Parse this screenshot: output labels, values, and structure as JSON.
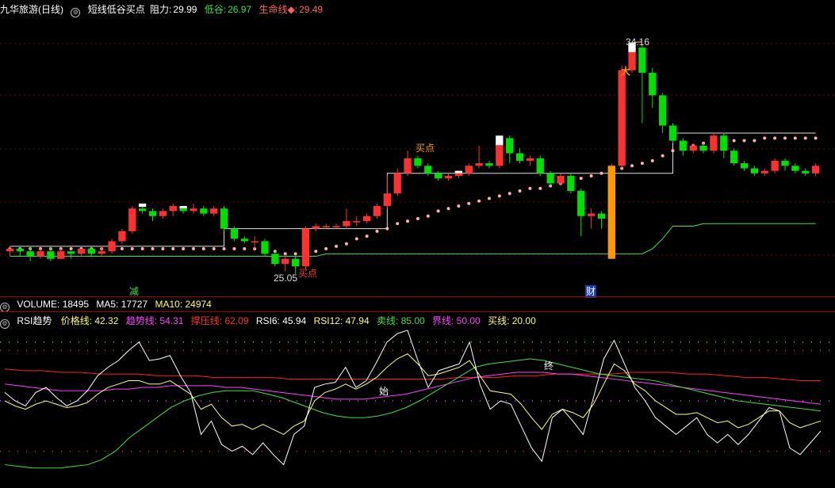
{
  "main": {
    "title": "九华旅游(日线)",
    "indicator": "短线低谷买点",
    "resistance_label": "阻力:",
    "resistance_value": "29.99",
    "valley_label": "低谷:",
    "valley_value": "26.97",
    "life_label": "生命线◆:",
    "life_value": "29.49",
    "high_label": "34.16",
    "low_label": "25.05",
    "buy_label": "买点",
    "marker_left": "减",
    "marker_right": "财",
    "signal_char": "大"
  },
  "volume": {
    "label": "VOLUME: 18495",
    "ma5": "MA5: 17727",
    "ma10": "MA10: 24974"
  },
  "rsi": {
    "title": "RSI趋势",
    "price_line": "价格线: 42.32",
    "trend_line": "趋势线: 54.31",
    "pressure_line": "撑压线: 62.09",
    "rsi6": "RSI6: 45.94",
    "rsi12": "RSI12: 47.94",
    "sell_line": "卖线: 85.00",
    "boundary_line": "界线: 50.00",
    "buy_line": "买线: 20.00",
    "mark_start": "始",
    "mark_end": "终"
  },
  "colors": {
    "up": "#ff3030",
    "down": "#00e000",
    "bg": "#000000",
    "rsi6": "#ffffff",
    "rsi12": "#ffff80",
    "trend": "#ff40ff",
    "pressure": "#ff2020",
    "life": "#40e040"
  },
  "chart_data": {
    "type": "candlestick",
    "y_range": [
      24.3,
      35.2
    ],
    "candles": [
      [
        25.9,
        26.0,
        25.7,
        26.1
      ],
      [
        26.0,
        25.9,
        25.7,
        26.1
      ],
      [
        25.9,
        25.7,
        25.5,
        26.1
      ],
      [
        25.7,
        25.9,
        25.6,
        26.0
      ],
      [
        25.9,
        25.6,
        25.5,
        26.1
      ],
      [
        25.6,
        25.9,
        25.6,
        26.0
      ],
      [
        25.9,
        25.8,
        25.6,
        25.9
      ],
      [
        25.8,
        26.0,
        25.7,
        26.0
      ],
      [
        26.0,
        25.8,
        25.7,
        26.1
      ],
      [
        25.8,
        25.9,
        25.7,
        26.1
      ],
      [
        25.9,
        26.3,
        25.8,
        26.4
      ],
      [
        26.3,
        26.7,
        26.2,
        26.8
      ],
      [
        26.7,
        27.6,
        26.6,
        27.7
      ],
      [
        27.6,
        27.5,
        27.4,
        27.8
      ],
      [
        27.5,
        27.3,
        27.1,
        27.6
      ],
      [
        27.3,
        27.5,
        27.2,
        27.6
      ],
      [
        27.5,
        27.7,
        27.3,
        27.8
      ],
      [
        27.7,
        27.5,
        27.4,
        27.7
      ],
      [
        27.5,
        27.6,
        27.4,
        27.8
      ],
      [
        27.6,
        27.4,
        27.3,
        27.7
      ],
      [
        27.4,
        27.6,
        27.3,
        27.7
      ],
      [
        27.6,
        26.8,
        26.7,
        27.7
      ],
      [
        26.8,
        26.4,
        26.3,
        26.9
      ],
      [
        26.4,
        26.3,
        26.2,
        26.5
      ],
      [
        26.3,
        26.3,
        26.0,
        26.5
      ],
      [
        26.3,
        25.8,
        25.7,
        26.4
      ],
      [
        25.8,
        25.4,
        25.3,
        25.9
      ],
      [
        25.4,
        25.6,
        25.1,
        25.7
      ],
      [
        25.6,
        25.3,
        25.0,
        25.7
      ],
      [
        25.3,
        26.8,
        25.2,
        26.9
      ],
      [
        26.8,
        26.9,
        26.7,
        27.0
      ],
      [
        26.9,
        26.9,
        26.8,
        27.0
      ],
      [
        26.9,
        26.9,
        26.8,
        27.0
      ],
      [
        26.9,
        27.1,
        26.8,
        27.6
      ],
      [
        27.1,
        27.1,
        26.9,
        27.3
      ],
      [
        27.1,
        27.3,
        27.0,
        27.4
      ],
      [
        27.3,
        27.7,
        27.2,
        27.8
      ],
      [
        27.7,
        28.2,
        27.6,
        28.9
      ],
      [
        28.2,
        29.0,
        28.1,
        29.2
      ],
      [
        29.0,
        29.6,
        28.9,
        29.9
      ],
      [
        29.6,
        29.3,
        29.2,
        29.7
      ],
      [
        29.3,
        29.0,
        28.9,
        29.4
      ],
      [
        29.0,
        28.8,
        28.7,
        29.1
      ],
      [
        28.8,
        28.9,
        28.7,
        29.0
      ],
      [
        28.9,
        29.0,
        28.8,
        29.1
      ],
      [
        29.0,
        29.3,
        28.9,
        29.4
      ],
      [
        29.3,
        29.4,
        29.2,
        30.1
      ],
      [
        29.4,
        29.3,
        29.2,
        29.5
      ],
      [
        29.3,
        30.4,
        29.2,
        30.5
      ],
      [
        30.4,
        29.8,
        29.4,
        30.5
      ],
      [
        29.8,
        29.5,
        29.4,
        30.0
      ],
      [
        29.5,
        29.6,
        29.3,
        29.7
      ],
      [
        29.6,
        29.0,
        28.9,
        29.7
      ],
      [
        29.0,
        28.6,
        28.5,
        29.1
      ],
      [
        28.6,
        28.9,
        28.5,
        29.0
      ],
      [
        28.9,
        28.3,
        28.2,
        29.0
      ],
      [
        28.3,
        27.3,
        26.5,
        28.4
      ],
      [
        27.3,
        27.4,
        26.8,
        27.6
      ],
      [
        27.4,
        27.2,
        26.8,
        27.5
      ],
      [
        27.2,
        29.3,
        27.1,
        29.4
      ],
      [
        29.3,
        33.1,
        29.2,
        33.3
      ],
      [
        33.1,
        34.0,
        33.0,
        34.2
      ],
      [
        34.0,
        33.0,
        31.0,
        34.1
      ],
      [
        33.0,
        32.1,
        31.6,
        33.2
      ],
      [
        32.1,
        30.9,
        30.6,
        32.2
      ],
      [
        30.9,
        30.3,
        30.2,
        31.0
      ],
      [
        30.3,
        29.9,
        29.7,
        30.4
      ],
      [
        29.9,
        30.1,
        29.8,
        30.2
      ],
      [
        30.1,
        29.9,
        29.8,
        30.2
      ],
      [
        29.9,
        30.5,
        29.8,
        30.6
      ],
      [
        30.5,
        29.9,
        29.6,
        30.6
      ],
      [
        29.9,
        29.4,
        29.3,
        30.0
      ],
      [
        29.4,
        29.2,
        29.1,
        29.5
      ],
      [
        29.2,
        29.0,
        28.9,
        29.3
      ],
      [
        29.0,
        29.1,
        28.9,
        29.2
      ],
      [
        29.1,
        29.5,
        29.0,
        29.6
      ],
      [
        29.5,
        29.3,
        29.1,
        29.6
      ],
      [
        29.3,
        29.1,
        29.0,
        29.4
      ],
      [
        29.1,
        29.0,
        28.9,
        29.2
      ],
      [
        29.0,
        29.3,
        28.9,
        29.4
      ]
    ],
    "life_line": [
      25.7,
      25.7,
      25.7,
      25.7,
      25.7,
      25.7,
      25.7,
      25.7,
      25.7,
      25.7,
      25.7,
      25.7,
      25.7,
      25.7,
      25.7,
      25.7,
      25.7,
      25.7,
      25.7,
      25.7,
      25.7,
      25.7,
      25.7,
      25.7,
      25.7,
      25.7,
      25.7,
      25.7,
      25.7,
      25.7,
      25.7,
      25.8,
      25.8,
      25.8,
      25.8,
      25.8,
      25.8,
      25.8,
      25.8,
      25.8,
      25.8,
      25.8,
      25.8,
      25.8,
      25.8,
      25.8,
      25.8,
      25.8,
      25.8,
      25.8,
      25.8,
      25.8,
      25.8,
      25.8,
      25.8,
      25.8,
      25.8,
      25.8,
      25.8,
      25.8,
      25.8,
      25.8,
      25.8,
      26.0,
      26.4,
      26.9,
      26.9,
      26.9,
      27.0,
      27.0,
      27.0,
      27.0,
      27.0,
      27.0,
      27.0,
      27.0,
      27.0,
      27.0,
      27.0,
      27.0
    ],
    "resistance_line": [
      26.1,
      26.1,
      26.1,
      26.1,
      26.1,
      26.1,
      26.1,
      26.1,
      26.1,
      26.1,
      26.1,
      26.1,
      26.1,
      26.1,
      26.1,
      26.1,
      26.1,
      26.1,
      26.1,
      26.1,
      26.1,
      26.8,
      26.8,
      26.8,
      26.8,
      26.8,
      26.8,
      26.8,
      26.8,
      26.8,
      26.8,
      26.8,
      26.8,
      26.8,
      26.8,
      26.8,
      26.8,
      29.0,
      29.0,
      29.0,
      29.0,
      29.0,
      29.0,
      29.0,
      29.0,
      29.0,
      29.0,
      29.0,
      29.0,
      29.0,
      29.0,
      29.0,
      29.0,
      29.0,
      29.0,
      29.0,
      29.0,
      29.0,
      29.0,
      29.0,
      29.0,
      29.0,
      29.0,
      29.0,
      29.0,
      30.6,
      30.6,
      30.6,
      30.6,
      30.6,
      30.6,
      30.6,
      30.6,
      30.6,
      30.6,
      30.6,
      30.6,
      30.6,
      30.6,
      30.6
    ],
    "dots": [
      26.0,
      26.0,
      26.0,
      26.0,
      26.0,
      26.0,
      26.0,
      26.0,
      26.0,
      26.0,
      26.0,
      26.0,
      26.0,
      26.0,
      26.0,
      26.0,
      26.0,
      26.0,
      26.0,
      26.0,
      26.0,
      26.0,
      26.0,
      26.0,
      26.0,
      26.0,
      25.9,
      25.8,
      25.8,
      25.8,
      25.9,
      26.0,
      26.1,
      26.2,
      26.4,
      26.5,
      26.7,
      26.8,
      27.0,
      27.1,
      27.2,
      27.3,
      27.5,
      27.6,
      27.7,
      27.8,
      27.9,
      28.0,
      28.1,
      28.2,
      28.3,
      28.4,
      28.4,
      28.5,
      28.6,
      28.7,
      28.8,
      28.9,
      29.0,
      29.1,
      29.2,
      29.3,
      29.4,
      29.5,
      29.7,
      29.9,
      30.0,
      30.1,
      30.2,
      30.2,
      30.3,
      30.3,
      30.3,
      30.3,
      30.4,
      30.4,
      30.4,
      30.4,
      30.4,
      30.4
    ],
    "rsi_range": [
      0,
      100
    ],
    "rsi6": [
      55,
      50,
      47,
      55,
      58,
      52,
      47,
      50,
      56,
      65,
      70,
      74,
      80,
      85,
      74,
      75,
      77,
      65,
      55,
      30,
      38,
      24,
      20,
      23,
      18,
      25,
      18,
      12,
      30,
      35,
      58,
      60,
      61,
      70,
      58,
      62,
      73,
      85,
      90,
      92,
      74,
      58,
      68,
      70,
      72,
      85,
      60,
      45,
      50,
      48,
      35,
      22,
      14,
      40,
      45,
      38,
      30,
      52,
      75,
      86,
      72,
      58,
      50,
      40,
      35,
      30,
      35,
      40,
      30,
      25,
      30,
      24,
      30,
      38,
      46,
      44,
      22,
      18,
      25,
      32
    ],
    "rsi12": [
      50,
      47,
      45,
      48,
      50,
      48,
      46,
      47,
      49,
      54,
      58,
      60,
      62,
      62,
      60,
      60,
      62,
      58,
      54,
      45,
      48,
      40,
      35,
      36,
      33,
      36,
      33,
      30,
      35,
      38,
      50,
      55,
      57,
      60,
      57,
      60,
      64,
      70,
      75,
      78,
      72,
      65,
      66,
      68,
      70,
      74,
      65,
      56,
      55,
      54,
      48,
      40,
      33,
      42,
      45,
      43,
      40,
      48,
      60,
      72,
      68,
      60,
      56,
      50,
      46,
      42,
      42,
      43,
      40,
      37,
      38,
      34,
      36,
      40,
      44,
      44,
      37,
      34,
      36,
      38
    ],
    "trend": [
      60,
      59,
      58,
      57,
      56,
      56,
      56,
      56,
      57,
      57,
      58,
      58,
      59,
      59,
      59,
      59,
      58,
      58,
      57,
      56,
      55,
      54,
      53,
      52,
      51,
      51,
      51,
      52,
      53,
      54,
      56,
      58,
      60,
      62,
      64,
      65,
      66,
      67,
      67,
      67,
      66,
      66,
      65,
      64,
      63,
      62,
      61,
      60,
      59,
      58,
      57,
      56,
      55,
      54,
      53,
      52,
      51,
      50,
      49,
      48
    ],
    "pressure": [
      69,
      68,
      68,
      67,
      67,
      66,
      66,
      66,
      65,
      65,
      65,
      64,
      64,
      64,
      64,
      63,
      63,
      63,
      63,
      63,
      63,
      63,
      63,
      63,
      64,
      64,
      64,
      65,
      65,
      66,
      66,
      66,
      66,
      67,
      67,
      67,
      66,
      66,
      65,
      64,
      64,
      63,
      62,
      62
    ],
    "life_rsi": [
      12,
      11,
      10,
      10,
      10,
      11,
      12,
      15,
      20,
      28,
      34,
      40,
      46,
      50,
      53,
      55,
      56,
      56,
      56,
      54,
      52,
      49,
      46,
      43,
      41,
      40,
      40,
      41,
      43,
      46,
      50,
      55,
      60,
      65,
      70,
      72,
      73,
      74,
      75,
      74,
      72,
      70,
      68,
      66,
      65,
      64,
      63,
      62,
      60,
      58,
      56,
      54,
      52,
      50,
      49,
      48,
      47,
      46,
      45,
      44
    ]
  }
}
